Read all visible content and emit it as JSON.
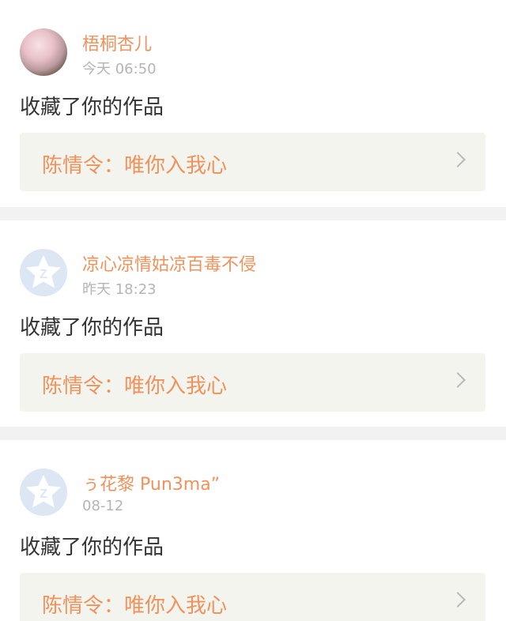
{
  "colors": {
    "accent": "#f0925c",
    "timestamp": "#b5b5b5",
    "body_text": "#333333",
    "card_bg": "#f4f4ee",
    "separator": "#f2f2f2",
    "top_indicator": "#e44d86"
  },
  "notifications": [
    {
      "user_name": "梧桐杏儿",
      "time": "今天 06:50",
      "avatar": "user-photo-avatar",
      "action": "收藏了你的作品",
      "work_title": "陈情令：唯你入我心"
    },
    {
      "user_name": "凉心凉情姑凉百毒不侵",
      "time": "昨天 18:23",
      "avatar": "default-qzone-avatar",
      "action": "收藏了你的作品",
      "work_title": "陈情令：唯你入我心"
    },
    {
      "user_name": "ぅ花黎 Pun3ma”",
      "time": "08-12",
      "avatar": "default-qzone-avatar",
      "action": "收藏了你的作品",
      "work_title": "陈情令：唯你入我心"
    }
  ]
}
